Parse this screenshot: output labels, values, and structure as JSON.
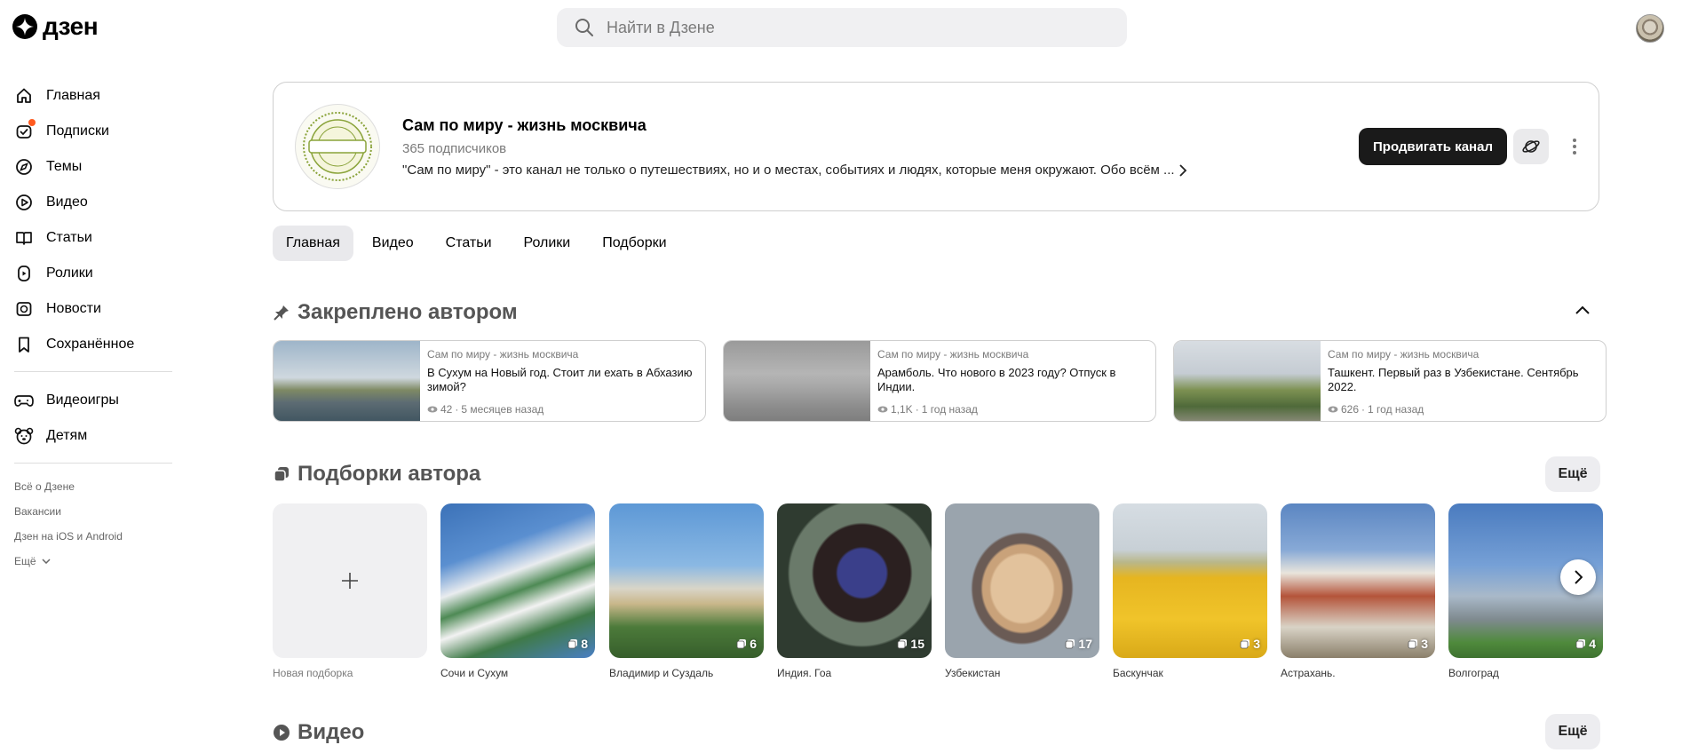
{
  "header": {
    "logo_text": "дзен",
    "search_placeholder": "Найти в Дзене"
  },
  "sidebar": {
    "items": [
      {
        "label": "Главная",
        "icon": "home-icon"
      },
      {
        "label": "Подписки",
        "icon": "subscriptions-icon",
        "has_badge": true
      },
      {
        "label": "Темы",
        "icon": "compass-icon"
      },
      {
        "label": "Видео",
        "icon": "play-icon"
      },
      {
        "label": "Статьи",
        "icon": "book-icon"
      },
      {
        "label": "Ролики",
        "icon": "shorts-icon"
      },
      {
        "label": "Новости",
        "icon": "news-icon"
      },
      {
        "label": "Сохранённое",
        "icon": "bookmark-icon"
      }
    ],
    "extra_items": [
      {
        "label": "Видеоигры",
        "icon": "gamepad-icon"
      },
      {
        "label": "Детям",
        "icon": "bear-icon"
      }
    ],
    "footer_links": [
      "Всё о Дзене",
      "Вакансии",
      "Дзен на iOS и Android",
      "Ещё"
    ]
  },
  "channel": {
    "title": "Сам по миру - жизнь москвича",
    "subscribers": "365 подписчиков",
    "description": "\"Сам по миру\" - это канал не только о путешествиях, но и о местах, событиях и людях, которые меня окружают. Обо всём ...",
    "avatar_text": "САМ ПО МИРУ",
    "promote_label": "Продвигать канал"
  },
  "tabs": [
    {
      "label": "Главная",
      "active": true
    },
    {
      "label": "Видео",
      "active": false
    },
    {
      "label": "Статьи",
      "active": false
    },
    {
      "label": "Ролики",
      "active": false
    },
    {
      "label": "Подборки",
      "active": false
    }
  ],
  "pinned": {
    "heading": "Закреплено автором",
    "items": [
      {
        "source": "Сам по миру - жизнь москвича",
        "title": "В Сухум на Новый год. Стоит ли ехать в Абхазию зимой?",
        "views": "42",
        "age": "5 месяцев назад"
      },
      {
        "source": "Сам по миру - жизнь москвича",
        "title": "Арамболь. Что нового в 2023 году? Отпуск в Индии.",
        "views": "1,1K",
        "age": "1 год назад"
      },
      {
        "source": "Сам по миру - жизнь москвича",
        "title": "Ташкент. Первый раз в Узбекистане. Сентябрь 2022.",
        "views": "626",
        "age": "1 год назад"
      }
    ]
  },
  "collections": {
    "heading": "Подборки автора",
    "more_label": "Ещё",
    "new_label": "Новая подборка",
    "items": [
      {
        "label": "Сочи и Сухум",
        "count": "8"
      },
      {
        "label": "Владимир и Суздаль",
        "count": "6"
      },
      {
        "label": "Индия. Гоа",
        "count": "15"
      },
      {
        "label": "Узбекистан",
        "count": "17"
      },
      {
        "label": "Баскунчак",
        "count": "3"
      },
      {
        "label": "Астрахань.",
        "count": "3"
      },
      {
        "label": "Волгоград",
        "count": "4"
      }
    ]
  },
  "video": {
    "heading": "Видео",
    "more_label": "Ещё"
  },
  "colors": {
    "accent_dark": "#1a1a1a",
    "badge": "#ff5a1f",
    "muted_text": "#7a7a7a"
  }
}
